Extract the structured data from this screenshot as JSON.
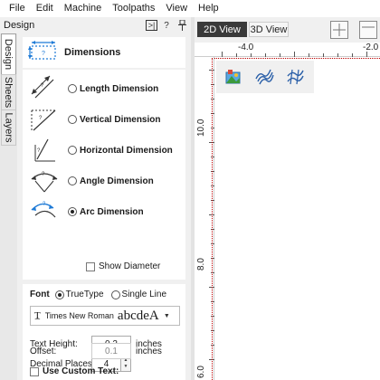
{
  "menu": [
    "File",
    "Edit",
    "Machine",
    "Toolpaths",
    "View",
    "Help"
  ],
  "panel": {
    "title": "Design",
    "header_buttons": {
      "toggle": ">|",
      "help": "?",
      "pin": "⇧"
    }
  },
  "side_tabs": [
    "Design",
    "Sheets",
    "Layers"
  ],
  "dimensions": {
    "title": "Dimensions",
    "options": [
      {
        "label": "Length Dimension",
        "checked": false
      },
      {
        "label": "Vertical Dimension",
        "checked": false
      },
      {
        "label": "Horizontal Dimension",
        "checked": false
      },
      {
        "label": "Angle Dimension",
        "checked": false
      },
      {
        "label": "Arc Dimension",
        "checked": true
      }
    ],
    "show_diameter": {
      "label": "Show Diameter",
      "checked": false
    }
  },
  "font": {
    "label": "Font",
    "truetype_label": "TrueType",
    "truetype_checked": true,
    "singleline_label": "Single Line",
    "singleline_checked": false,
    "font_name": "Times New Roman",
    "preview": "abcdeA"
  },
  "fields": {
    "text_height": {
      "label": "Text Height:",
      "value": "0.2",
      "unit": "inches"
    },
    "decimal_places": {
      "label": "Decimal Places:",
      "value": "4"
    },
    "offset": {
      "label": "Offset:",
      "value": "0.1",
      "unit": "inches"
    }
  },
  "custom_text": {
    "label": "Use Custom Text:",
    "checked": false
  },
  "view_tabs": {
    "tab_2d": "2D View",
    "tab_3d": "3D View",
    "active": "2D View"
  },
  "ruler": {
    "top_labels": [
      "-4.0",
      "-2.0"
    ],
    "left_labels": [
      "10.0",
      "8.0",
      "6.0"
    ]
  },
  "mini_toolbar": [
    "image-icon",
    "wave-lines-icon",
    "hatch-icon"
  ]
}
